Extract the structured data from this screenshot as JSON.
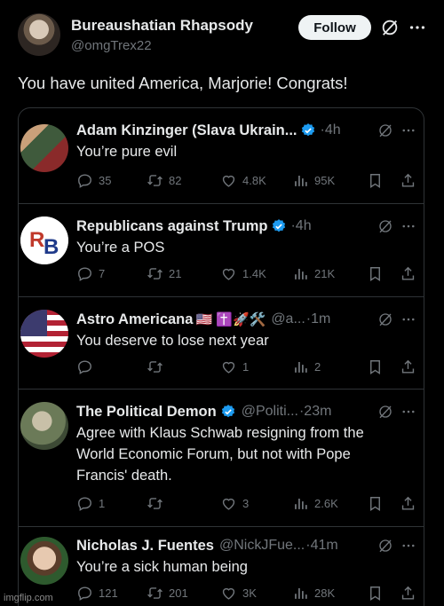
{
  "post": {
    "author_name": "Bureaushatian Rhapsody",
    "author_handle": "@omgTrex22",
    "follow_label": "Follow",
    "text": "You have united America, Marjorie! Congrats!"
  },
  "replies": [
    {
      "name": "Adam Kinzinger (Slava Ukrain...",
      "verified": true,
      "handle": "",
      "time": "·4h",
      "text": "You’re pure evil",
      "replies": "35",
      "reposts": "82",
      "likes": "4.8K",
      "views": "95K"
    },
    {
      "name": "Republicans against Trump",
      "verified": true,
      "handle": "",
      "time": "·4h",
      "text": "You’re a POS",
      "replies": "7",
      "reposts": "21",
      "likes": "1.4K",
      "views": "21K"
    },
    {
      "name": "Astro Americana",
      "emoji": "🇺🇸 ✝️🚀🛠️",
      "verified": false,
      "handle": "@a...",
      "time": "·1m",
      "text": "You deserve to lose next year",
      "replies": "",
      "reposts": "",
      "likes": "1",
      "views": "2"
    },
    {
      "name": "The Political Demon",
      "verified": true,
      "handle": "@Politi...",
      "time": "·23m",
      "text": "Agree with Klaus Schwab resigning from the World Economic Forum, but not with Pope Francis' death.",
      "replies": "1",
      "reposts": "",
      "likes": "3",
      "views": "2.6K"
    },
    {
      "name": "Nicholas J. Fuentes",
      "verified": false,
      "handle": "@NickJFue...",
      "time": "·41m",
      "text": "You’re a sick human being",
      "replies": "121",
      "reposts": "201",
      "likes": "3K",
      "views": "28K"
    }
  ],
  "icons": {
    "reply": "reply-icon",
    "repost": "repost-icon",
    "like": "heart-icon",
    "views": "views-icon",
    "bookmark": "bookmark-icon",
    "share": "share-icon",
    "grok": "grok-icon",
    "more": "more-icon",
    "verified": "verified-badge-icon"
  },
  "colors": {
    "background": "#000000",
    "text": "#e7e9ea",
    "muted": "#71767b",
    "border": "#2f3336",
    "verified": "#1d9bf0"
  },
  "watermark": "imgflip.com"
}
